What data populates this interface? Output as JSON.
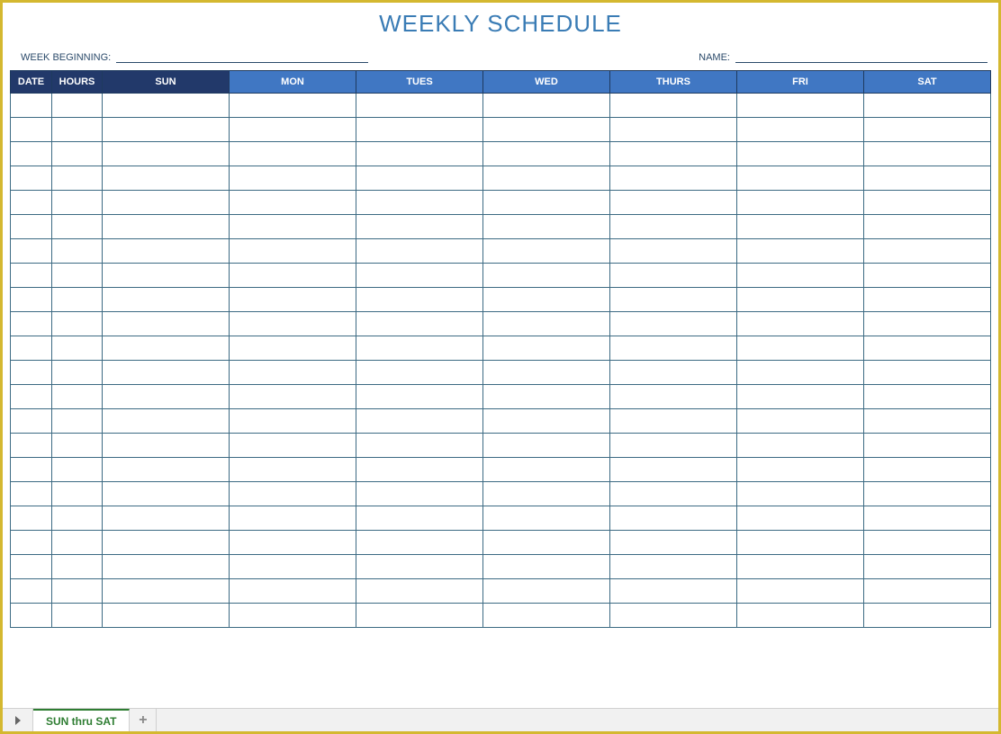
{
  "title": "WEEKLY SCHEDULE",
  "meta": {
    "week_beginning_label": "WEEK BEGINNING:",
    "week_beginning_value": "",
    "name_label": "NAME:",
    "name_value": ""
  },
  "columns": [
    {
      "key": "date",
      "label": "DATE",
      "style": "dark"
    },
    {
      "key": "hours",
      "label": "HOURS",
      "style": "dark"
    },
    {
      "key": "sun",
      "label": "SUN",
      "style": "dark"
    },
    {
      "key": "mon",
      "label": "MON",
      "style": "light"
    },
    {
      "key": "tues",
      "label": "TUES",
      "style": "light"
    },
    {
      "key": "wed",
      "label": "WED",
      "style": "light"
    },
    {
      "key": "thurs",
      "label": "THURS",
      "style": "light"
    },
    {
      "key": "fri",
      "label": "FRI",
      "style": "light"
    },
    {
      "key": "sat",
      "label": "SAT",
      "style": "light"
    }
  ],
  "row_count": 22,
  "tabs": {
    "active": "SUN thru SAT"
  }
}
